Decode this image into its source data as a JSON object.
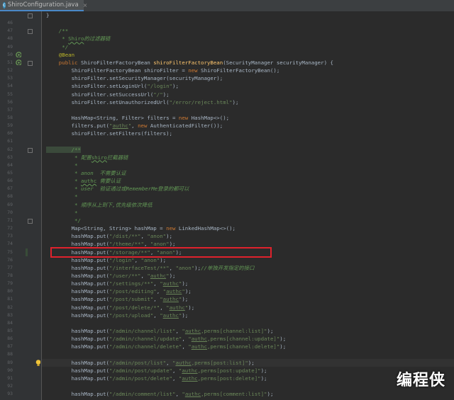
{
  "tabs": [
    {
      "label": "ShiroConfiguration.java",
      "icon": "java-class-icon",
      "close": "×"
    }
  ],
  "watermark": "编程侠",
  "highlight_color": "#e0222c",
  "lines": [
    {
      "n": "",
      "tokens": [
        [
          "plain",
          "}"
        ]
      ]
    },
    {
      "n": "46",
      "tokens": []
    },
    {
      "n": "47",
      "tokens": [
        [
          "cm",
          "    /**"
        ]
      ]
    },
    {
      "n": "48",
      "tokens": [
        [
          "cm",
          "     * "
        ],
        [
          "typo",
          "Shiro"
        ],
        [
          "cm",
          "的过滤器链"
        ]
      ]
    },
    {
      "n": "49",
      "tokens": [
        [
          "cm",
          "     */"
        ]
      ]
    },
    {
      "n": "50",
      "tokens": [
        [
          "ann",
          "    @Bean"
        ]
      ]
    },
    {
      "n": "51",
      "tokens": [
        [
          "kw",
          "    public "
        ],
        [
          "plain",
          "ShiroFilterFactoryBean "
        ],
        [
          "fn",
          "shiroFilterFactoryBean"
        ],
        [
          "plain",
          "(SecurityManager securityManager) {"
        ]
      ]
    },
    {
      "n": "52",
      "tokens": [
        [
          "plain",
          "        ShiroFilterFactoryBean shiroFilter = "
        ],
        [
          "kw",
          "new "
        ],
        [
          "plain",
          "ShiroFilterFactoryBean();"
        ]
      ]
    },
    {
      "n": "53",
      "tokens": [
        [
          "plain",
          "        shiroFilter.setSecurityManager(securityManager);"
        ]
      ]
    },
    {
      "n": "54",
      "tokens": [
        [
          "plain",
          "        shiroFilter.setLoginUrl("
        ],
        [
          "str",
          "\"/login\""
        ],
        [
          "plain",
          ");"
        ]
      ]
    },
    {
      "n": "55",
      "tokens": [
        [
          "plain",
          "        shiroFilter.setSuccessUrl("
        ],
        [
          "str",
          "\"/\""
        ],
        [
          "plain",
          ");"
        ]
      ]
    },
    {
      "n": "56",
      "tokens": [
        [
          "plain",
          "        shiroFilter.setUnauthorizedUrl("
        ],
        [
          "str",
          "\"/error/reject.html\""
        ],
        [
          "plain",
          ");"
        ]
      ]
    },
    {
      "n": "57",
      "tokens": []
    },
    {
      "n": "58",
      "tokens": [
        [
          "plain",
          "        HashMap<String, Filter> filters = "
        ],
        [
          "kw",
          "new "
        ],
        [
          "plain",
          "HashMap<>();"
        ]
      ]
    },
    {
      "n": "59",
      "tokens": [
        [
          "plain",
          "        filters.put("
        ],
        [
          "str",
          "\""
        ],
        [
          "typos",
          "authc"
        ],
        [
          "str",
          "\""
        ],
        [
          "plain",
          ", "
        ],
        [
          "kw",
          "new "
        ],
        [
          "plain",
          "AuthenticatedFilter());"
        ]
      ]
    },
    {
      "n": "60",
      "tokens": [
        [
          "plain",
          "        shiroFilter.setFilters(filters);"
        ]
      ]
    },
    {
      "n": "61",
      "tokens": []
    },
    {
      "n": "62",
      "tokens": [
        [
          "tag",
          "        /**"
        ]
      ]
    },
    {
      "n": "63",
      "tokens": [
        [
          "cm",
          "         * 配置"
        ],
        [
          "typo",
          "shiro"
        ],
        [
          "cm",
          "拦截器链"
        ]
      ]
    },
    {
      "n": "64",
      "tokens": [
        [
          "cm",
          "         *"
        ]
      ]
    },
    {
      "n": "65",
      "tokens": [
        [
          "cm",
          "         * anon  不需要认证"
        ]
      ]
    },
    {
      "n": "66",
      "tokens": [
        [
          "cm",
          "         * "
        ],
        [
          "typo",
          "authc"
        ],
        [
          "cm",
          " 需要认证"
        ]
      ]
    },
    {
      "n": "67",
      "tokens": [
        [
          "cm",
          "         * user  验证通过或RememberMe登录的都可以"
        ]
      ]
    },
    {
      "n": "68",
      "tokens": [
        [
          "cm",
          "         *"
        ]
      ]
    },
    {
      "n": "69",
      "tokens": [
        [
          "cm",
          "         * 顺序从上到下,优先级依次降低"
        ]
      ]
    },
    {
      "n": "70",
      "tokens": [
        [
          "cm",
          "         *"
        ]
      ]
    },
    {
      "n": "71",
      "tokens": [
        [
          "cm",
          "         */"
        ]
      ]
    },
    {
      "n": "72",
      "tokens": [
        [
          "plain",
          "        Map<String, String> hashMap = "
        ],
        [
          "kw",
          "new "
        ],
        [
          "plain",
          "LinkedHashMap<>();"
        ]
      ]
    },
    {
      "n": "73",
      "tokens": [
        [
          "plain",
          "        hashMap.put("
        ],
        [
          "str",
          "\"/dist/**\""
        ],
        [
          "plain",
          ", "
        ],
        [
          "str",
          "\"anon\""
        ],
        [
          "plain",
          ");"
        ]
      ]
    },
    {
      "n": "74",
      "tokens": [
        [
          "plain",
          "        hashMap.put("
        ],
        [
          "str",
          "\"/theme/**\""
        ],
        [
          "plain",
          ", "
        ],
        [
          "str",
          "\"anon\""
        ],
        [
          "plain",
          ");"
        ]
      ]
    },
    {
      "n": "75",
      "tokens": [
        [
          "plain",
          "        hashMap.put("
        ],
        [
          "str",
          "\"/storage/**\""
        ],
        [
          "plain",
          ", "
        ],
        [
          "str",
          "\"anon\""
        ],
        [
          "plain",
          ");"
        ]
      ]
    },
    {
      "n": "76",
      "tokens": [
        [
          "plain",
          "        hashMap.put("
        ],
        [
          "str",
          "\"/login\""
        ],
        [
          "plain",
          ", "
        ],
        [
          "str",
          "\"anon\""
        ],
        [
          "plain",
          ");"
        ]
      ]
    },
    {
      "n": "77",
      "tokens": [
        [
          "plain",
          "        hashMap.put("
        ],
        [
          "str",
          "\"/interfaceTest/**\""
        ],
        [
          "plain",
          ", "
        ],
        [
          "str",
          "\"anon\""
        ],
        [
          "plain",
          ");"
        ],
        [
          "cm",
          "//单独开发指定的接口"
        ]
      ]
    },
    {
      "n": "78",
      "tokens": [
        [
          "plain",
          "        hashMap.put("
        ],
        [
          "str",
          "\"/user/**\""
        ],
        [
          "plain",
          ", "
        ],
        [
          "str",
          "\""
        ],
        [
          "typos",
          "authc"
        ],
        [
          "str",
          "\""
        ],
        [
          "plain",
          ");"
        ]
      ]
    },
    {
      "n": "79",
      "tokens": [
        [
          "plain",
          "        hashMap.put("
        ],
        [
          "str",
          "\"/settings/**\""
        ],
        [
          "plain",
          ", "
        ],
        [
          "str",
          "\""
        ],
        [
          "typos",
          "authc"
        ],
        [
          "str",
          "\""
        ],
        [
          "plain",
          ");"
        ]
      ]
    },
    {
      "n": "80",
      "tokens": [
        [
          "plain",
          "        hashMap.put("
        ],
        [
          "str",
          "\"/post/editing\""
        ],
        [
          "plain",
          ", "
        ],
        [
          "str",
          "\""
        ],
        [
          "typos",
          "authc"
        ],
        [
          "str",
          "\""
        ],
        [
          "plain",
          ");"
        ]
      ]
    },
    {
      "n": "81",
      "tokens": [
        [
          "plain",
          "        hashMap.put("
        ],
        [
          "str",
          "\"/post/submit\""
        ],
        [
          "plain",
          ", "
        ],
        [
          "str",
          "\""
        ],
        [
          "typos",
          "authc"
        ],
        [
          "str",
          "\""
        ],
        [
          "plain",
          ");"
        ]
      ]
    },
    {
      "n": "82",
      "tokens": [
        [
          "plain",
          "        hashMap.put("
        ],
        [
          "str",
          "\"/post/delete/*\""
        ],
        [
          "plain",
          ", "
        ],
        [
          "str",
          "\""
        ],
        [
          "typos",
          "authc"
        ],
        [
          "str",
          "\""
        ],
        [
          "plain",
          ");"
        ]
      ]
    },
    {
      "n": "83",
      "tokens": [
        [
          "plain",
          "        hashMap.put("
        ],
        [
          "str",
          "\"/post/upload\""
        ],
        [
          "plain",
          ", "
        ],
        [
          "str",
          "\""
        ],
        [
          "typos",
          "authc"
        ],
        [
          "str",
          "\""
        ],
        [
          "plain",
          ");"
        ]
      ]
    },
    {
      "n": "84",
      "tokens": []
    },
    {
      "n": "85",
      "tokens": [
        [
          "plain",
          "        hashMap.put("
        ],
        [
          "str",
          "\"/admin/channel/list\""
        ],
        [
          "plain",
          ", "
        ],
        [
          "str",
          "\""
        ],
        [
          "typos",
          "authc"
        ],
        [
          "str",
          ",perms[channel:list]\""
        ],
        [
          "plain",
          ");"
        ]
      ]
    },
    {
      "n": "86",
      "tokens": [
        [
          "plain",
          "        hashMap.put("
        ],
        [
          "str",
          "\"/admin/channel/update\""
        ],
        [
          "plain",
          ", "
        ],
        [
          "str",
          "\""
        ],
        [
          "typos",
          "authc"
        ],
        [
          "str",
          ",perms[channel:update]\""
        ],
        [
          "plain",
          ");"
        ]
      ]
    },
    {
      "n": "87",
      "tokens": [
        [
          "plain",
          "        hashMap.put("
        ],
        [
          "str",
          "\"/admin/channel/delete\""
        ],
        [
          "plain",
          ", "
        ],
        [
          "str",
          "\""
        ],
        [
          "typos",
          "authc"
        ],
        [
          "str",
          ",perms[channel:delete]\""
        ],
        [
          "plain",
          ");"
        ]
      ]
    },
    {
      "n": "88",
      "tokens": []
    },
    {
      "n": "89",
      "tokens": [
        [
          "plain",
          "        hashMap.put("
        ],
        [
          "str",
          "\"/admin/post/list\""
        ],
        [
          "plain",
          ", "
        ],
        [
          "str",
          "\""
        ],
        [
          "typos",
          "authc"
        ],
        [
          "str",
          ",perms[post:list]\""
        ],
        [
          "plain",
          ");"
        ]
      ]
    },
    {
      "n": "90",
      "tokens": [
        [
          "plain",
          "        hashMap.put("
        ],
        [
          "str",
          "\"/admin/post/update\""
        ],
        [
          "plain",
          ", "
        ],
        [
          "str",
          "\""
        ],
        [
          "typos",
          "authc"
        ],
        [
          "str",
          ",perms[post:update]\""
        ],
        [
          "plain",
          ");"
        ]
      ]
    },
    {
      "n": "91",
      "tokens": [
        [
          "plain",
          "        hashMap.put("
        ],
        [
          "str",
          "\"/admin/post/delete\""
        ],
        [
          "plain",
          ", "
        ],
        [
          "str",
          "\""
        ],
        [
          "typos",
          "authc"
        ],
        [
          "str",
          ",perms[post:delete]\""
        ],
        [
          "plain",
          ");"
        ]
      ]
    },
    {
      "n": "92",
      "tokens": []
    },
    {
      "n": "93",
      "tokens": [
        [
          "plain",
          "        hashMap.put("
        ],
        [
          "str",
          "\"/admin/comment/list\""
        ],
        [
          "plain",
          ", "
        ],
        [
          "str",
          "\""
        ],
        [
          "typos",
          "authc"
        ],
        [
          "str",
          ",perms[comment:list]\""
        ],
        [
          "plain",
          ");"
        ]
      ]
    }
  ]
}
